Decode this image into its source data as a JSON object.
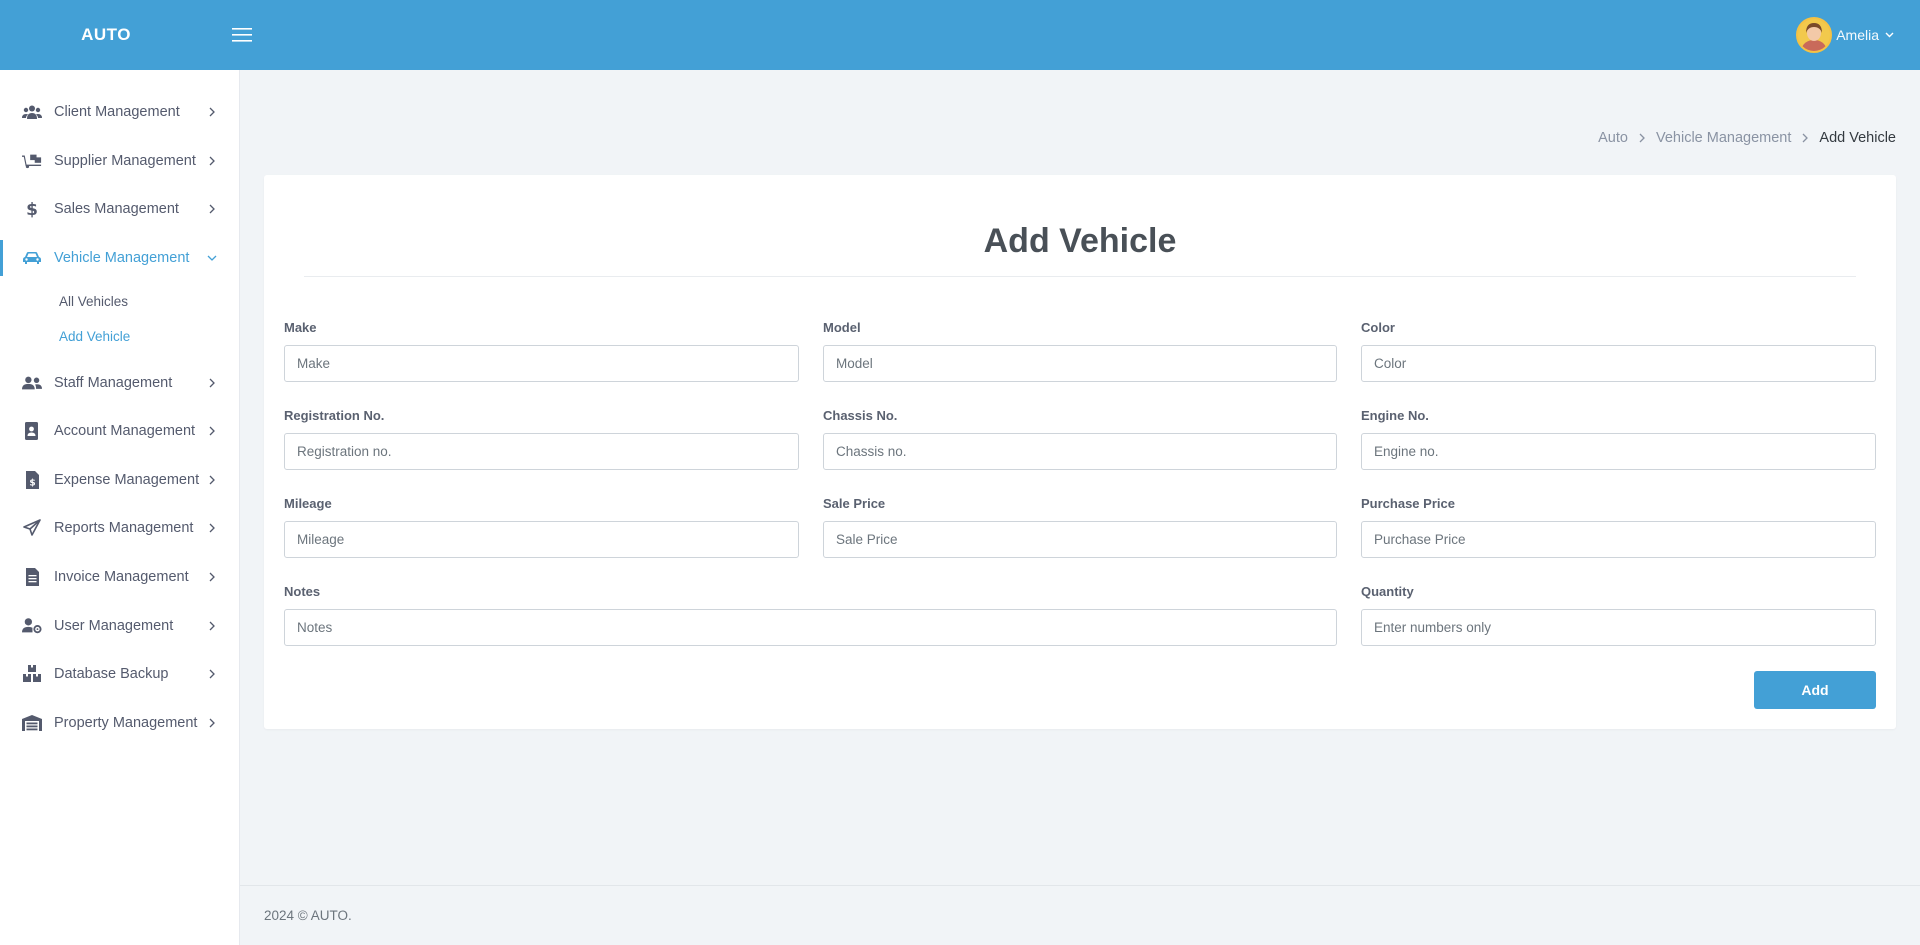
{
  "topbar": {
    "brand": "AUTO",
    "user_name": "Amelia"
  },
  "sidebar": {
    "items": [
      {
        "label": "Client Management",
        "icon": "users-icon"
      },
      {
        "label": "Supplier Management",
        "icon": "truck-loading-icon"
      },
      {
        "label": "Sales Management",
        "icon": "dollar-icon"
      },
      {
        "label": "Vehicle Management",
        "icon": "car-icon",
        "expanded": true
      },
      {
        "label": "Staff Management",
        "icon": "user-group-icon"
      },
      {
        "label": "Account Management",
        "icon": "address-book-icon"
      },
      {
        "label": "Expense Management",
        "icon": "invoice-dollar-icon"
      },
      {
        "label": "Reports Management",
        "icon": "paper-plane-icon"
      },
      {
        "label": "Invoice Management",
        "icon": "file-icon"
      },
      {
        "label": "User Management",
        "icon": "user-cog-icon"
      },
      {
        "label": "Database Backup",
        "icon": "boxes-icon"
      },
      {
        "label": "Property Management",
        "icon": "warehouse-icon"
      }
    ],
    "vehicle_sub": [
      {
        "label": "All Vehicles"
      },
      {
        "label": "Add Vehicle",
        "active": true
      }
    ]
  },
  "breadcrumb": {
    "items": [
      "Auto",
      "Vehicle Management"
    ],
    "current": "Add Vehicle"
  },
  "form": {
    "title": "Add Vehicle",
    "fields": {
      "make": {
        "label": "Make",
        "placeholder": "Make"
      },
      "model": {
        "label": "Model",
        "placeholder": "Model"
      },
      "color": {
        "label": "Color",
        "placeholder": "Color"
      },
      "registration": {
        "label": "Registration No.",
        "placeholder": "Registration no."
      },
      "chassis": {
        "label": "Chassis No.",
        "placeholder": "Chassis no."
      },
      "engine": {
        "label": "Engine No.",
        "placeholder": "Engine no."
      },
      "mileage": {
        "label": "Mileage",
        "placeholder": "Mileage"
      },
      "sale_price": {
        "label": "Sale Price",
        "placeholder": "Sale Price"
      },
      "purchase_price": {
        "label": "Purchase Price",
        "placeholder": "Purchase Price"
      },
      "notes": {
        "label": "Notes",
        "placeholder": "Notes"
      },
      "quantity": {
        "label": "Quantity",
        "placeholder": "Enter numbers only"
      }
    },
    "submit_label": "Add"
  },
  "footer": {
    "text": "2024 © AUTO."
  },
  "colors": {
    "accent": "#43a0d6",
    "background": "#f1f4f7"
  }
}
